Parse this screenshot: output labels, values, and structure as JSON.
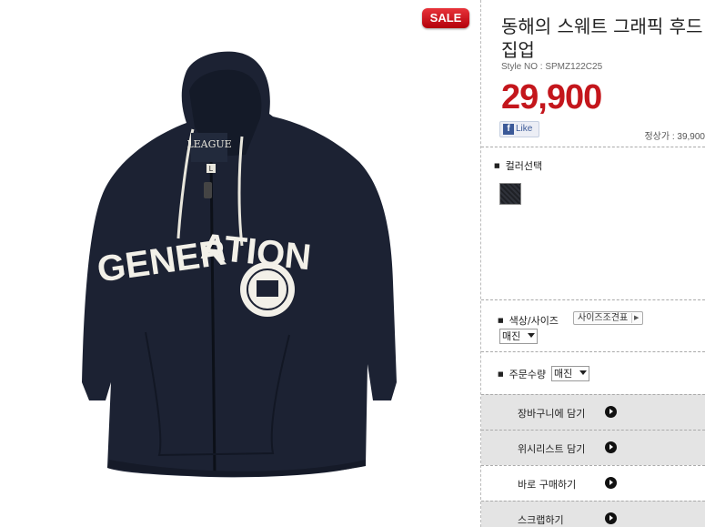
{
  "product": {
    "badge": "SALE",
    "title": "동해의 스웨트 그래픽 후드 집업",
    "style_no": "Style NO : SPMZ122C25",
    "price": "29,900",
    "list_price": "정상가 : 39,900",
    "image_graphic": {
      "chest_text_left": "GENER",
      "chest_text_right": "ATION",
      "neck_label": "LEAGUE",
      "size_tag": "L"
    }
  },
  "social": {
    "like_label": "Like",
    "fb_glyph": "f"
  },
  "options": {
    "color_label": "컬러선택",
    "color_size_label": "색상/사이즈",
    "size_guide_label": "사이즈조견표",
    "color_size_value": "매진",
    "quantity_label": "주문수량",
    "quantity_value": "매진"
  },
  "actions": [
    {
      "label": "장바구니에 담기"
    },
    {
      "label": "위시리스트 담기"
    },
    {
      "label": "바로 구매하기"
    },
    {
      "label": "스크랩하기"
    }
  ],
  "colors": {
    "price": "#c4161c",
    "sale_badge": "#d0161e",
    "hoodie": "#1c2233",
    "print": "#f2f0e8"
  }
}
